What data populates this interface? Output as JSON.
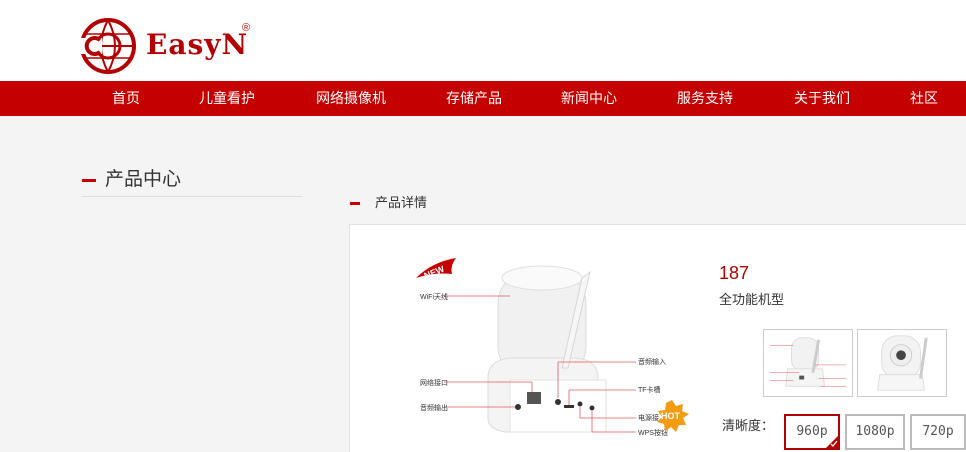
{
  "brand": {
    "name": "EasyN",
    "reg": "®",
    "color": "#b30000"
  },
  "nav": {
    "items": [
      "首页",
      "儿童看护",
      "网络摄像机",
      "存储产品",
      "新闻中心",
      "服务支持",
      "关于我们",
      "社区"
    ]
  },
  "sidebar": {
    "title": "产品中心"
  },
  "section": {
    "title": "产品详情"
  },
  "product": {
    "model": "187",
    "description": "全功能机型",
    "image_labels": {
      "badge_new": "NEW",
      "badge_hot": "HOT",
      "wifi": "WiFi天线",
      "audio_in": "音频输入",
      "network": "网络接口",
      "tf": "TF卡槽",
      "audio_out": "音频输出",
      "power": "电源接",
      "wps": "WPS按钮"
    },
    "resolution_label": "清晰度：",
    "resolutions": [
      "960p",
      "1080p",
      "720p"
    ],
    "selected_resolution": "960p"
  },
  "colors": {
    "nav_bg": "#c40000",
    "accent": "#b30000"
  }
}
